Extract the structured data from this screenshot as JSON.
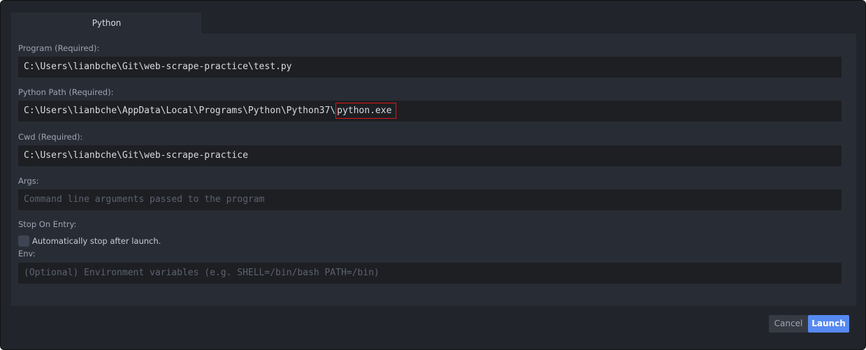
{
  "tabs": [
    {
      "label": "Python",
      "active": true
    }
  ],
  "fields": {
    "program": {
      "label": "Program (Required):",
      "value": "C:\\Users\\lianbche\\Git\\web-scrape-practice\\test.py"
    },
    "python_path": {
      "label": "Python Path (Required):",
      "value_prefix": "C:\\Users\\lianbche\\AppData\\Local\\Programs\\Python\\Python37\\",
      "value_highlighted": "python.exe"
    },
    "cwd": {
      "label": "Cwd (Required):",
      "value": "C:\\Users\\lianbche\\Git\\web-scrape-practice"
    },
    "args": {
      "label": "Args:",
      "placeholder": "Command line arguments passed to the program"
    },
    "stop_on_entry": {
      "label": "Stop On Entry:",
      "checkbox_label": "Automatically stop after launch.",
      "checked": false
    },
    "env": {
      "label": "Env:",
      "placeholder": "(Optional) Environment variables (e.g. SHELL=/bin/bash PATH=/bin)"
    }
  },
  "buttons": {
    "cancel": "Cancel",
    "launch": "Launch"
  },
  "colors": {
    "accent": "#568af2",
    "highlight_box": "#e0161b"
  }
}
